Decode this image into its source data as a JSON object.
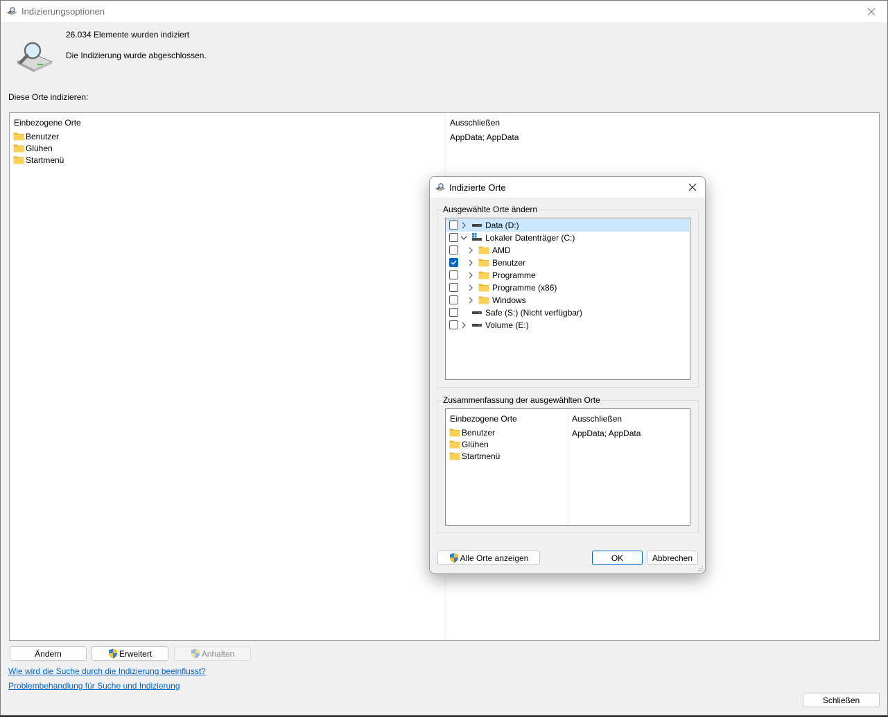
{
  "window": {
    "title": "Indizierungsoptionen",
    "app_icon": "indexing-icon",
    "close_icon": "close-icon"
  },
  "status": {
    "items_indexed": "26.034 Elemente wurden indiziert",
    "state": "Die Indizierung wurde abgeschlossen."
  },
  "locations_label": "Diese Orte indizieren:",
  "locations": {
    "included_header": "Einbezogene Orte",
    "excluded_header": "Ausschließen",
    "items": [
      "Benutzer",
      "Glühen",
      "Startmenü"
    ],
    "excluded": "AppData; AppData"
  },
  "buttons": {
    "change": "Ändern",
    "advanced": "Erweitert",
    "pause": "Anhalten",
    "close": "Schließen"
  },
  "links": {
    "help": "Wie wird die Suche durch die Indizierung beeinflusst?",
    "troubleshoot": "Problembehandlung für Suche und Indizierung"
  },
  "dialog": {
    "title": "Indizierte Orte",
    "change_group_label": "Ausgewählte Orte ändern",
    "tree": [
      {
        "label": "Data (D:)",
        "checked": false,
        "expander": "chevron-right",
        "icon": "drive-icon",
        "selected": true
      },
      {
        "label": "Lokaler Datenträger (C:)",
        "checked": false,
        "expander": "chevron-down",
        "icon": "system-drive-icon",
        "selected": false
      },
      {
        "label": "AMD",
        "checked": false,
        "expander": "chevron-right",
        "icon": "folder-icon",
        "selected": false
      },
      {
        "label": "Benutzer",
        "checked": true,
        "expander": "chevron-right",
        "icon": "folder-icon",
        "selected": false
      },
      {
        "label": "Programme",
        "checked": false,
        "expander": "chevron-right",
        "icon": "folder-icon",
        "selected": false
      },
      {
        "label": "Programme (x86)",
        "checked": false,
        "expander": "chevron-right",
        "icon": "folder-icon",
        "selected": false
      },
      {
        "label": "Windows",
        "checked": false,
        "expander": "chevron-right",
        "icon": "folder-icon",
        "selected": false
      },
      {
        "label": "Safe (S:) (Nicht verfügbar)",
        "checked": false,
        "expander": "none",
        "icon": "drive-icon",
        "selected": false
      },
      {
        "label": "Volume (E:)",
        "checked": false,
        "expander": "chevron-right",
        "icon": "drive-icon",
        "selected": false
      }
    ],
    "summary_group_label": "Zusammenfassung der ausgewählten Orte",
    "summary": {
      "included_header": "Einbezogene Orte",
      "excluded_header": "Ausschließen",
      "items": [
        "Benutzer",
        "Glühen",
        "Startmenü"
      ],
      "excluded": "AppData; AppData"
    },
    "buttons": {
      "show_all": "Alle Orte anzeigen",
      "ok": "OK",
      "cancel": "Abbrechen"
    }
  },
  "colors": {
    "accent": "#0067c0",
    "link": "#0066cc",
    "folder": "#f8c841",
    "selection": "#cce8ff"
  }
}
